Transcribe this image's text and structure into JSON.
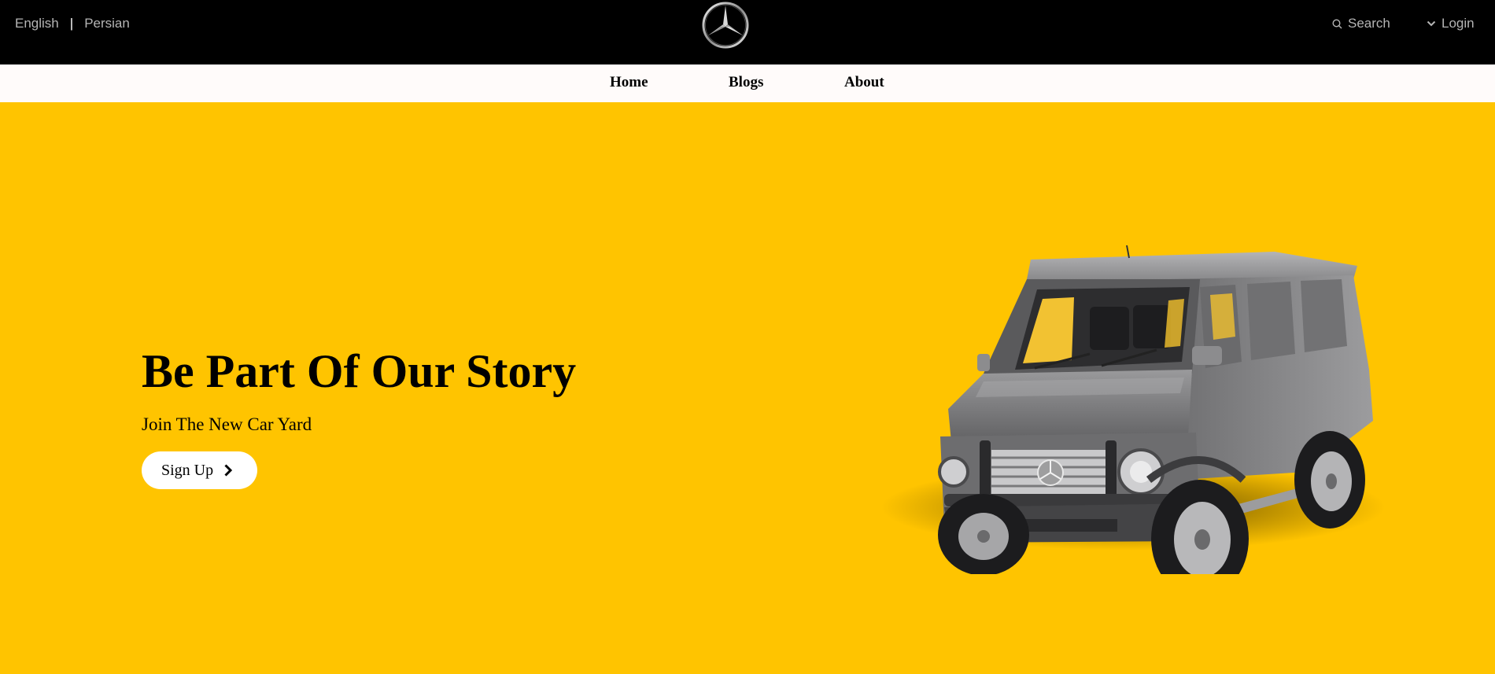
{
  "header": {
    "languages": {
      "english": "English",
      "separator": "|",
      "persian": "Persian"
    },
    "logo_icon": "mercedes-star-icon",
    "search_label": "Search",
    "search_icon": "search-icon",
    "login_label": "Login",
    "login_icon": "chevron-down-icon"
  },
  "nav": {
    "items": [
      {
        "label": "Home"
      },
      {
        "label": "Blogs"
      },
      {
        "label": "About"
      }
    ]
  },
  "hero": {
    "title": "Be Part Of Our Story",
    "subtitle": "Join The New Car Yard",
    "button_label": "Sign Up",
    "button_icon": "chevron-right-icon",
    "image": "grey-suv-car-image"
  },
  "colors": {
    "topbar": "#000000",
    "navbar": "#FFFBFA",
    "hero_bg": "#FFC400",
    "header_text": "#B5B5B5",
    "button_bg": "#FFFFFF"
  }
}
